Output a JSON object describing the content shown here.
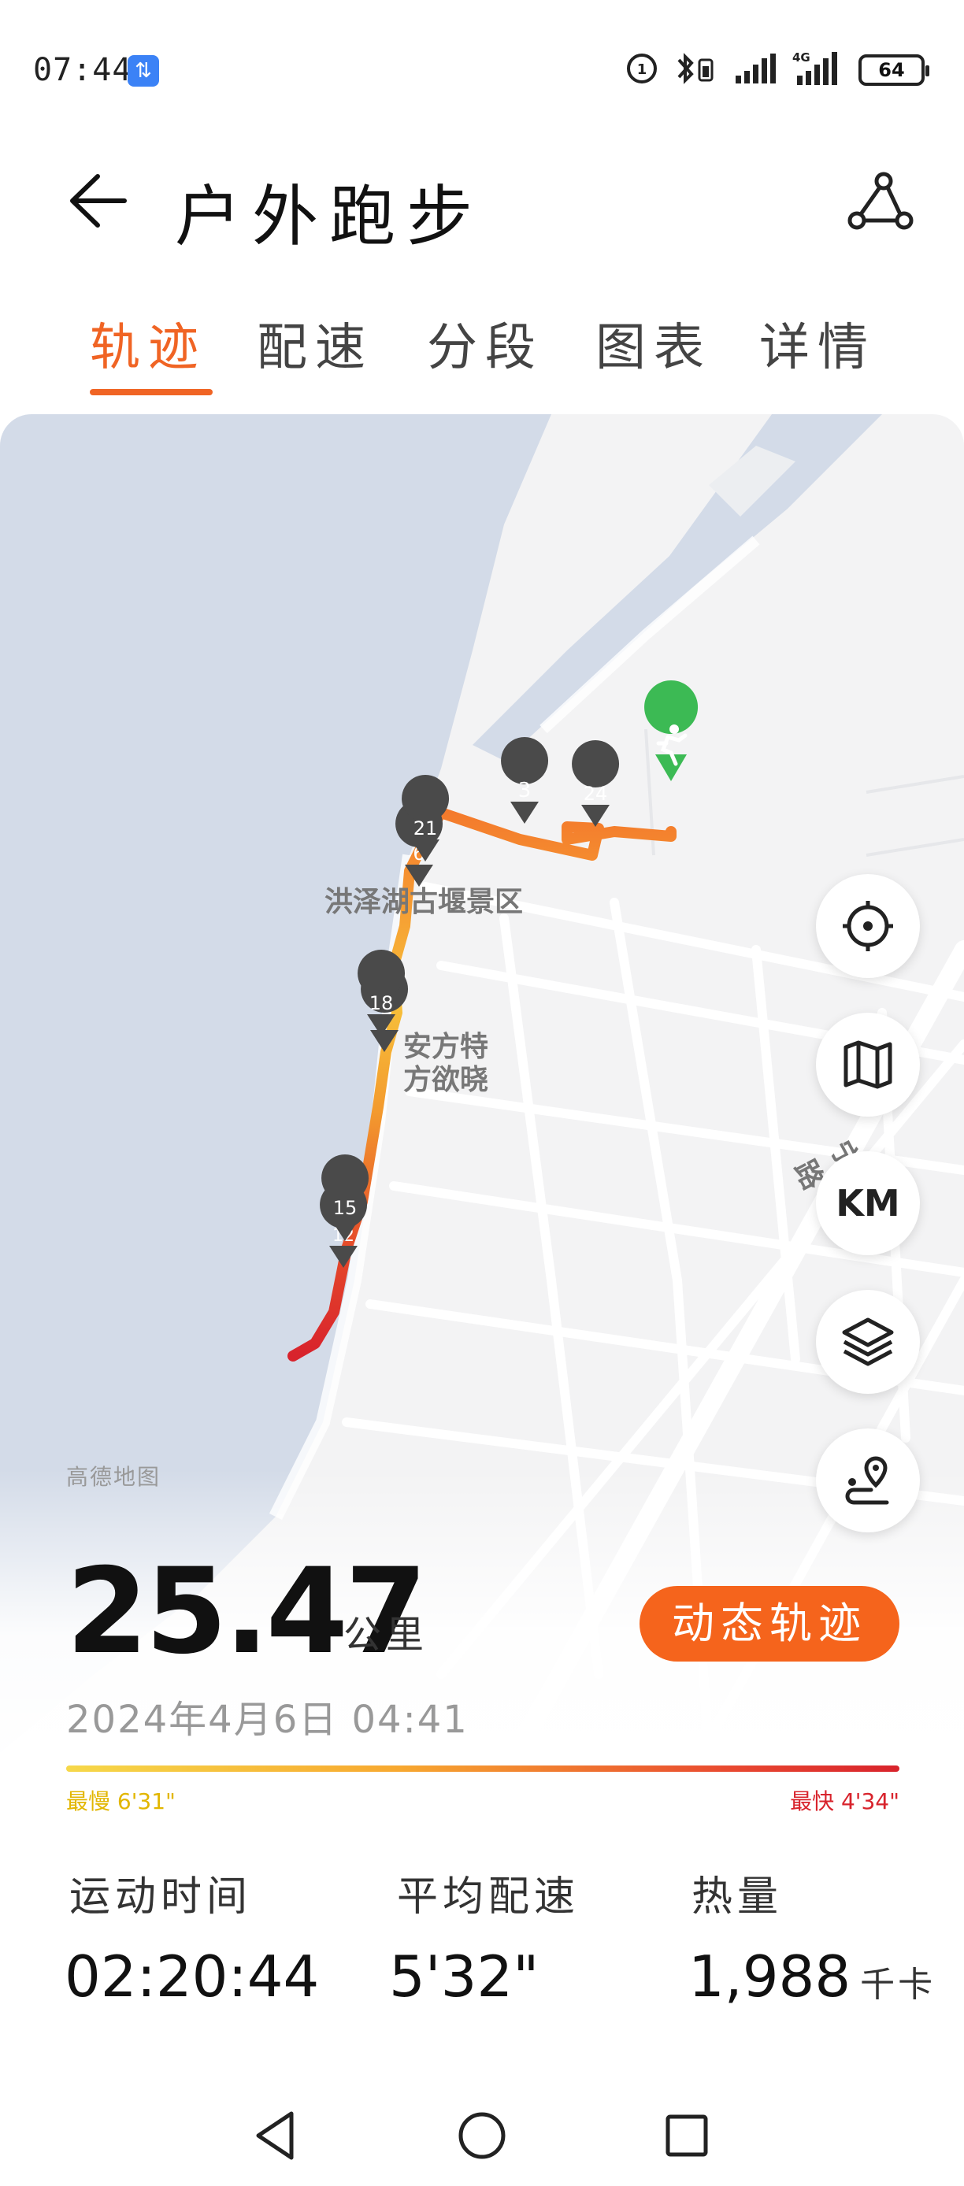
{
  "status_bar": {
    "time": "07:44",
    "data_indicator": "⇅",
    "network": "4G",
    "battery": "64"
  },
  "header": {
    "title": "户外跑步",
    "back_icon": "arrow-left-icon",
    "share_icon": "route-share-icon"
  },
  "tabs": [
    {
      "label": "轨迹",
      "active": true
    },
    {
      "label": "配速",
      "active": false
    },
    {
      "label": "分段",
      "active": false
    },
    {
      "label": "图表",
      "active": false
    },
    {
      "label": "详情",
      "active": false
    }
  ],
  "map": {
    "place_labels": [
      "洪泽湖古堰景区",
      "安方特",
      "方欲晓"
    ],
    "road_label": "宁连公路",
    "provider": "高德地图",
    "km_markers": [
      "3",
      "24",
      "21",
      "6",
      "18",
      "15",
      "12"
    ],
    "buttons": {
      "locate": "crosshair-icon",
      "map_type": "map-icon",
      "km": "KM",
      "layers": "layers-icon",
      "route": "route-pin-icon"
    },
    "start_marker": "runner-icon"
  },
  "summary": {
    "distance": "25.47",
    "distance_unit": "公里",
    "replay_button": "动态轨迹",
    "datetime": "2024年4月6日 04:41",
    "pace_slowest": "最慢 6'31\"",
    "pace_fastest": "最快 4'34\""
  },
  "stats": [
    {
      "label": "运动时间",
      "value": "02:20:44",
      "unit": ""
    },
    {
      "label": "平均配速",
      "value": "5'32\"",
      "unit": ""
    },
    {
      "label": "热量",
      "value": "1,988",
      "unit": "千卡"
    }
  ],
  "colors": {
    "accent": "#f06424",
    "pace_slow": "#f6d84a",
    "pace_fast": "#d8232c",
    "water": "#d2dae8",
    "start_marker": "#3cba54"
  },
  "nav_bar": {
    "back": "nav-back-icon",
    "home": "nav-home-icon",
    "recents": "nav-recents-icon"
  }
}
